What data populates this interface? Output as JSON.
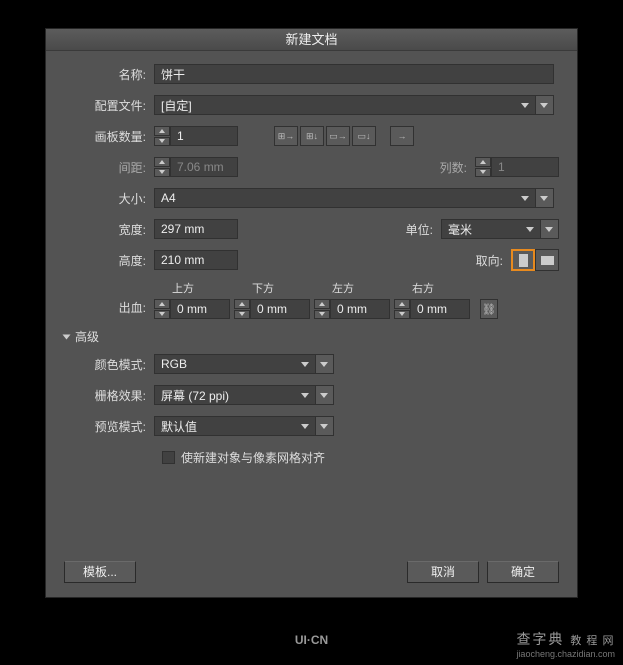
{
  "dialog": {
    "title": "新建文档"
  },
  "form": {
    "name_label": "名称:",
    "name_value": "饼干",
    "profile_label": "配置文件:",
    "profile_value": "[自定]",
    "artboards_label": "画板数量:",
    "artboards_value": "1",
    "spacing_label": "间距:",
    "spacing_value": "7.06 mm",
    "columns_label": "列数:",
    "columns_value": "1",
    "size_label": "大小:",
    "size_value": "A4",
    "width_label": "宽度:",
    "width_value": "297 mm",
    "units_label": "单位:",
    "units_value": "毫米",
    "height_label": "高度:",
    "height_value": "210 mm",
    "orient_label": "取向:",
    "bleed_label": "出血:",
    "bleed_top_label": "上方",
    "bleed_bottom_label": "下方",
    "bleed_left_label": "左方",
    "bleed_right_label": "右方",
    "bleed_top": "0 mm",
    "bleed_bottom": "0 mm",
    "bleed_left": "0 mm",
    "bleed_right": "0 mm",
    "advanced_label": "高级",
    "colormode_label": "颜色模式:",
    "colormode_value": "RGB",
    "raster_label": "栅格效果:",
    "raster_value": "屏幕 (72 ppi)",
    "preview_label": "预览模式:",
    "preview_value": "默认值",
    "align_checkbox_label": "使新建对象与像素网格对齐"
  },
  "footer": {
    "template_btn": "模板...",
    "cancel_btn": "取消",
    "ok_btn": "确定"
  },
  "watermark": {
    "brand": "查字典",
    "sub": "jiaocheng.chazidian.com",
    "tag": "教 程 网",
    "logo": "UI·CN"
  }
}
